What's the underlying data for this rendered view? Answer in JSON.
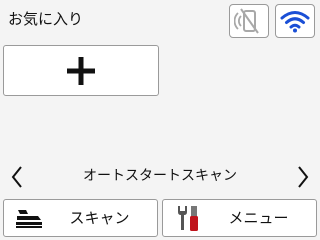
{
  "favorites": {
    "title": "お気に入り"
  },
  "status_icons": [
    {
      "name": "nfc-icon",
      "state": "disabled"
    },
    {
      "name": "wifi-icon",
      "state": "connected",
      "color": "#1a4fd6"
    }
  ],
  "add_button_icon": "plus-icon",
  "shortcut_nav": {
    "label": "オートスタートスキャン"
  },
  "bottom_bar": {
    "scan_label": "スキャン",
    "scan_icon": "scanner-icon",
    "menu_label": "メニュー",
    "menu_icon": "tools-icon",
    "menu_icon_color": "#c0141c"
  }
}
